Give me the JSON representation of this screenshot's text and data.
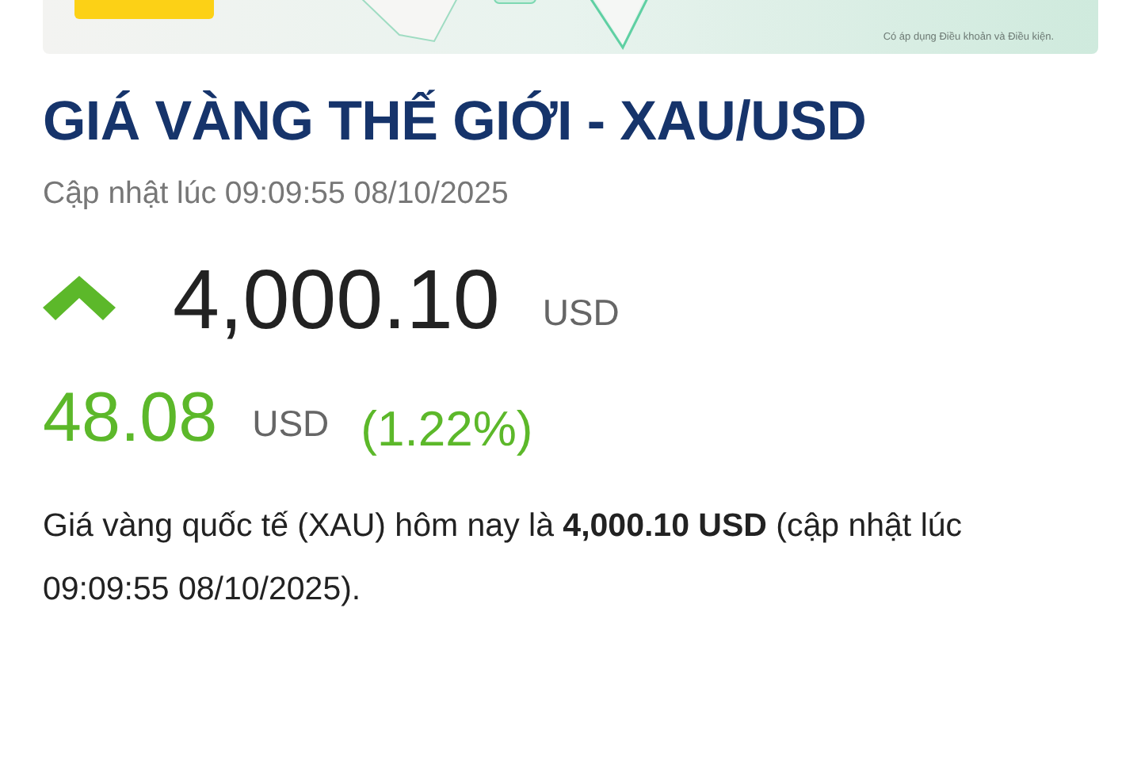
{
  "banner": {
    "kind": "picture",
    "disclaimer": "Có áp dụng Điều khoản và Điều kiện."
  },
  "title": "GIÁ VÀNG THẾ GIỚI - XAU/USD",
  "updated": "Cập nhật lúc 09:09:55 08/10/2025",
  "price": {
    "rising": true,
    "value": "4,000.10",
    "currency": "USD"
  },
  "change": {
    "value": "48.08",
    "currency": "USD",
    "percent": "(1.22%)"
  },
  "description": "Giá vàng quốc tế (XAU) hôm nay là **4,000.10 USD** (cập nhật lúc 09:09:55 08/10/2025)."
}
